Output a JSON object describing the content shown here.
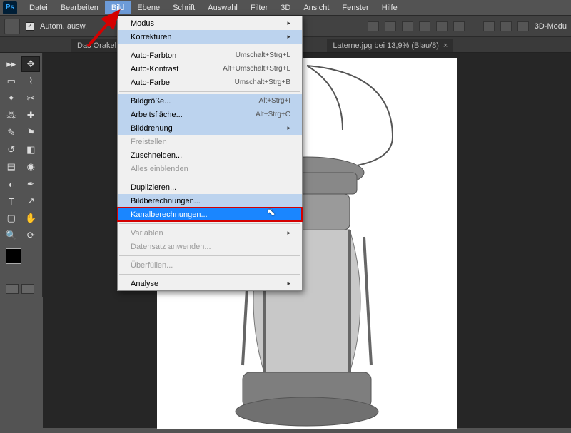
{
  "menubar": {
    "items": [
      "Datei",
      "Bearbeiten",
      "Bild",
      "Ebene",
      "Schrift",
      "Auswahl",
      "Filter",
      "3D",
      "Ansicht",
      "Fenster",
      "Hilfe"
    ],
    "active_index": 2
  },
  "optionbar": {
    "checkbox_label": "Autom. ausw.",
    "right_label": "3D-Modu"
  },
  "tabs": [
    {
      "label": "Das Orakel de"
    },
    {
      "label": "Laterne.jpg bei 13,9% (Blau/8)"
    }
  ],
  "dropdown": {
    "groups": [
      [
        {
          "label": "Modus",
          "sub": true,
          "state": ""
        },
        {
          "label": "Korrekturen",
          "sub": true,
          "state": "hover"
        }
      ],
      [
        {
          "label": "Auto-Farbton",
          "shortcut": "Umschalt+Strg+L"
        },
        {
          "label": "Auto-Kontrast",
          "shortcut": "Alt+Umschalt+Strg+L"
        },
        {
          "label": "Auto-Farbe",
          "shortcut": "Umschalt+Strg+B"
        }
      ],
      [
        {
          "label": "Bildgröße...",
          "shortcut": "Alt+Strg+I",
          "state": "hover"
        },
        {
          "label": "Arbeitsfläche...",
          "shortcut": "Alt+Strg+C",
          "state": "hover"
        },
        {
          "label": "Bilddrehung",
          "sub": true,
          "state": "hover"
        },
        {
          "label": "Freistellen",
          "disabled": true
        },
        {
          "label": "Zuschneiden..."
        },
        {
          "label": "Alles einblenden",
          "disabled": true
        }
      ],
      [
        {
          "label": "Duplizieren..."
        },
        {
          "label": "Bildberechnungen...",
          "state": "hover"
        },
        {
          "label": "Kanalberechnungen...",
          "state": "selected"
        }
      ],
      [
        {
          "label": "Variablen",
          "sub": true,
          "disabled": true
        },
        {
          "label": "Datensatz anwenden...",
          "disabled": true
        }
      ],
      [
        {
          "label": "Überfüllen...",
          "disabled": true
        }
      ],
      [
        {
          "label": "Analyse",
          "sub": true
        }
      ]
    ]
  },
  "tools": {
    "rows": [
      [
        "move",
        "marquee"
      ],
      [
        "lasso",
        "wand"
      ],
      [
        "crop",
        "eyedrop"
      ],
      [
        "heal",
        "brush"
      ],
      [
        "stamp",
        "history"
      ],
      [
        "eraser",
        "gradient"
      ],
      [
        "blur",
        "dodge"
      ],
      [
        "pen",
        "type"
      ],
      [
        "path",
        "shape"
      ],
      [
        "hand",
        "zoom"
      ]
    ]
  },
  "logo": "Ps"
}
